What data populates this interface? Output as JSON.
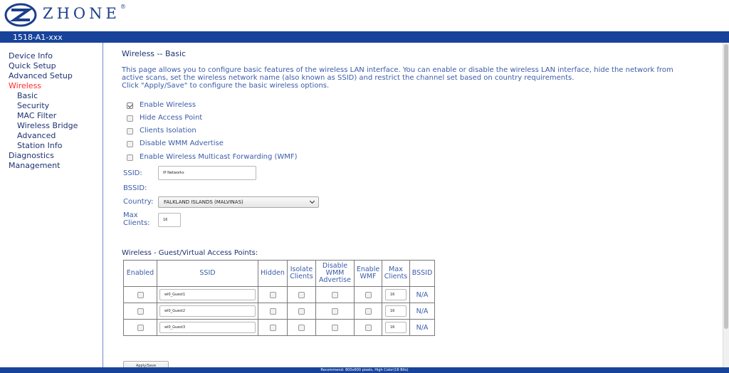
{
  "header": {
    "brand": "ZHONE",
    "trademark": "®",
    "model": "1518-A1-xxx"
  },
  "sidebar": {
    "items": [
      {
        "label": "Device Info"
      },
      {
        "label": "Quick Setup"
      },
      {
        "label": "Advanced Setup"
      },
      {
        "label": "Wireless"
      },
      {
        "label": "Basic"
      },
      {
        "label": "Security"
      },
      {
        "label": "MAC Filter"
      },
      {
        "label": "Wireless Bridge"
      },
      {
        "label": "Advanced"
      },
      {
        "label": "Station Info"
      },
      {
        "label": "Diagnostics"
      },
      {
        "label": "Management"
      }
    ]
  },
  "main": {
    "title": "Wireless -- Basic",
    "desc_line1": "This page allows you to configure basic features of the wireless LAN interface. You can enable or disable the wireless LAN interface, hide the network from",
    "desc_line2": "active scans, set the wireless network name (also known as SSID) and restrict the channel set based on country requirements.",
    "desc_line3": "Click \"Apply/Save\" to configure the basic wireless options.",
    "options": {
      "enable_wireless": "Enable Wireless",
      "hide_ap": "Hide Access Point",
      "clients_isolation": "Clients Isolation",
      "disable_wmm": "Disable WMM Advertise",
      "wmf": "Enable Wireless Multicast Forwarding (WMF)"
    },
    "ssid_label": "SSID:",
    "ssid_value": "IP Networks",
    "bssid_label": "BSSID:",
    "country_label": "Country:",
    "country_value": "FALKLAND ISLANDS (MALVINAS)",
    "max_clients_label_1": "Max",
    "max_clients_label_2": "Clients:",
    "max_clients_value": "16"
  },
  "guest": {
    "title": "Wireless - Guest/Virtual Access Points:",
    "headers": {
      "enabled": "Enabled",
      "ssid": "SSID",
      "hidden": "Hidden",
      "isolate_1": "Isolate",
      "isolate_2": "Clients",
      "wmm_1": "Disable",
      "wmm_2": "WMM",
      "wmm_3": "Advertise",
      "wmf_1": "Enable",
      "wmf_2": "WMF",
      "max_1": "Max",
      "max_2": "Clients",
      "bssid": "BSSID"
    },
    "rows": [
      {
        "ssid": "wl0_Guest1",
        "max_clients": "16",
        "bssid": "N/A"
      },
      {
        "ssid": "wl0_Guest2",
        "max_clients": "16",
        "bssid": "N/A"
      },
      {
        "ssid": "wl0_Guest3",
        "max_clients": "16",
        "bssid": "N/A"
      }
    ]
  },
  "apply_label": "Apply/Save",
  "footer": "Recommend: 800x600 pixels, High Color(16 Bits)",
  "colors": {
    "brand_blue": "#17439b",
    "active_nav": "#ff2a2a",
    "text_blue": "#3a5ca8"
  }
}
